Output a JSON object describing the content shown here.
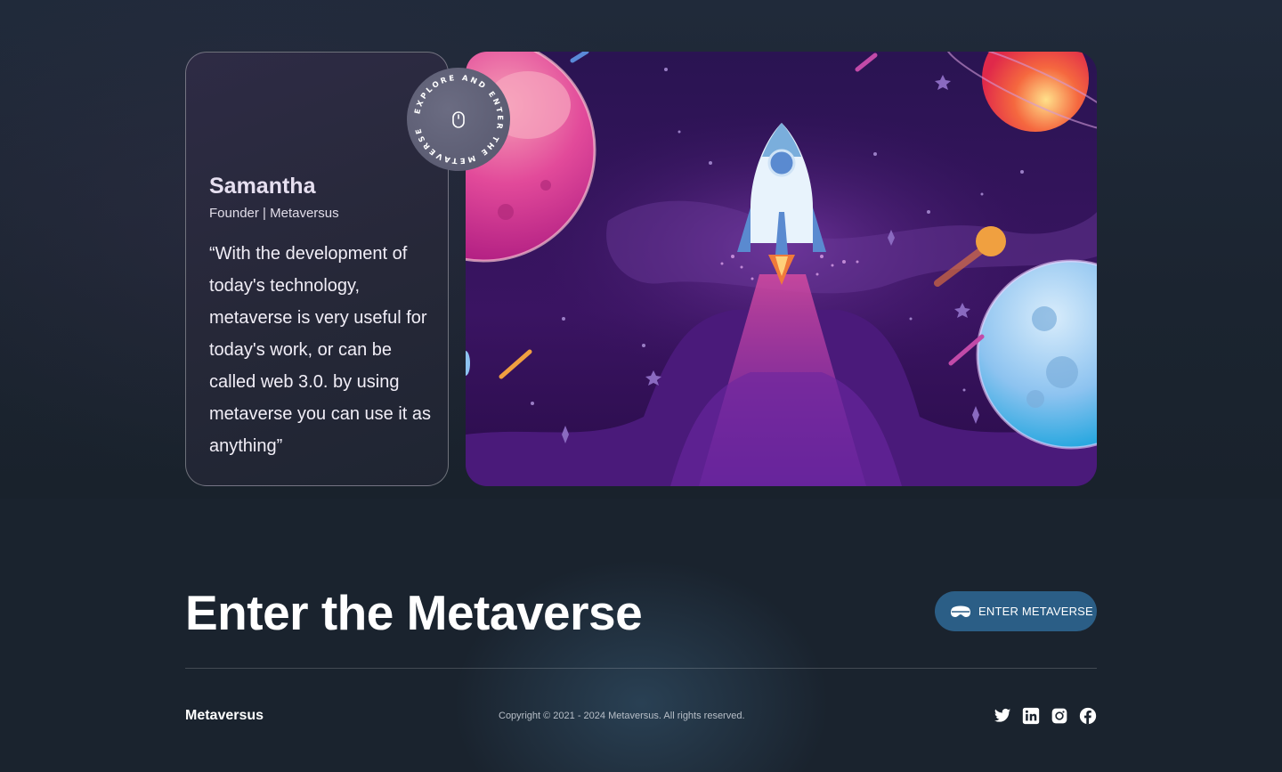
{
  "testimonial": {
    "name": "Samantha",
    "role": "Founder | Metaversus",
    "quote": "“With the development of today's technology, metaverse is very useful for today's work, or can be called web 3.0. by using metaverse you can use it as anything”"
  },
  "badge": {
    "circular_text": "EXPLORE AND ENTER THE METAVERSE",
    "icon": "mouse-icon"
  },
  "cta": {
    "title": "Enter the Metaverse",
    "button_label": "ENTER METAVERSE",
    "button_icon": "vr-headset-icon"
  },
  "footer": {
    "brand": "Metaversus",
    "copyright": "Copyright © 2021 - 2024 Metaversus. All rights reserved.",
    "socials": [
      "twitter-icon",
      "linkedin-icon",
      "instagram-icon",
      "facebook-icon"
    ]
  },
  "colors": {
    "background": "#1a232e",
    "button": "#2b5e86",
    "card_border": "#8a8a9a"
  }
}
